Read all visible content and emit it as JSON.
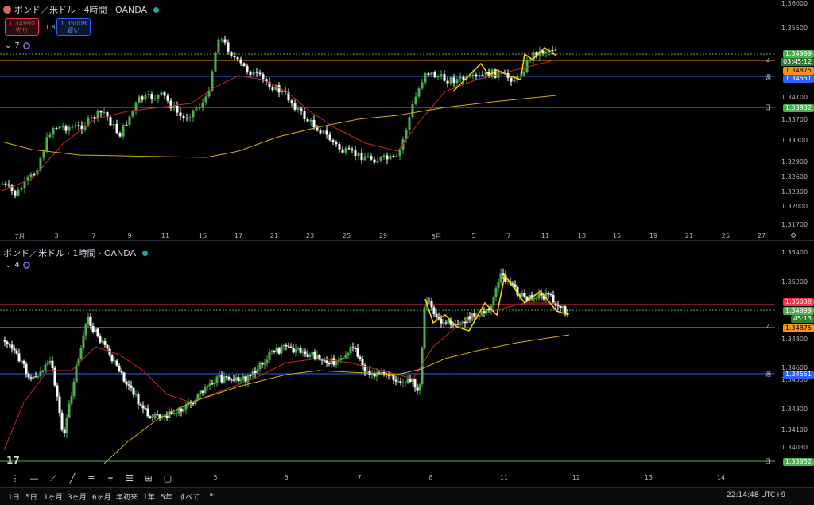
{
  "top": {
    "title": "ポンド／米ドル · 4時間 · OANDA",
    "sell_price": "1.34990",
    "sell_label": "売り",
    "spread": "1.8",
    "buy_price": "1.35008",
    "buy_label": "買い",
    "indicator_count": "7",
    "y_ticks": [
      "1.36000",
      "1.35500",
      "1.34100",
      "1.33700",
      "1.33300",
      "1.32900",
      "1.32600",
      "1.32300",
      "1.32000",
      "1.31700"
    ],
    "x_ticks": [
      "7月",
      "3",
      "7",
      "9",
      "11",
      "15",
      "17",
      "21",
      "23",
      "25",
      "29",
      "8月",
      "5",
      "7",
      "11",
      "13",
      "15",
      "19",
      "21",
      "25",
      "27"
    ],
    "labels": {
      "price": "1.34999",
      "countdown": "03:45:12",
      "line4_tag": "4",
      "line4": "1.34875",
      "week_tag": "週",
      "week": "1.34551",
      "day_tag": "日",
      "day": "1.33932"
    }
  },
  "bottom": {
    "title": "ポンド／米ドル · 1時間 · OANDA",
    "indicator_count": "4",
    "y_ticks": [
      "1.35400",
      "1.35200",
      "1.34800",
      "1.34600",
      "1.34550",
      "1.34300",
      "1.34100",
      "1.34030"
    ],
    "x_ticks": [
      "5",
      "6",
      "7",
      "8",
      "11",
      "12",
      "13",
      "14"
    ],
    "labels": {
      "red": "1.35038",
      "price": "1.34999",
      "countdown": "45:13",
      "line4_tag": "4",
      "line4": "1.34875",
      "week_tag": "週",
      "week": "1.34551",
      "day_tag": "日",
      "day": "1.33932"
    }
  },
  "toolbar": {
    "ranges": [
      "1日",
      "5日",
      "1ヶ月",
      "3ヶ月",
      "6ヶ月",
      "年初来",
      "1年",
      "5年",
      "すべて"
    ],
    "clock": "22:14:48 UTC+9"
  },
  "colors": {
    "up": "#4caf50",
    "down": "#ffffff",
    "ma_red": "#c62828",
    "ma_yellow": "#d4b106",
    "line_orange": "#f7931a",
    "line_blue": "#2962ff",
    "line_green": "#4caf50",
    "line_red": "#f23645"
  }
}
